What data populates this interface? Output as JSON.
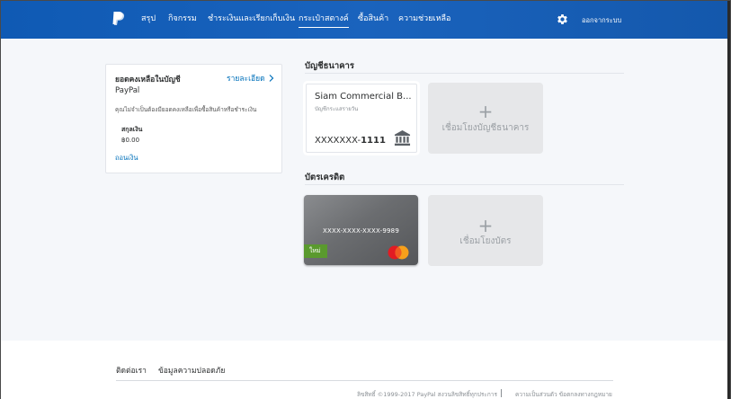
{
  "header": {
    "nav": [
      {
        "label": "สรุป"
      },
      {
        "label": "กิจกรรม"
      },
      {
        "label": "ชำระเงินและเรียกเก็บเงิน"
      },
      {
        "label": "กระเป๋าสตางค์"
      },
      {
        "label": "ซื้อสินค้า"
      },
      {
        "label": "ความช่วยเหลือ"
      }
    ],
    "active_tab": "กระเป๋าสตางค์",
    "logout_label": "ออกจากระบบ",
    "settings_icon": "gear-icon",
    "logo_icon": "paypal-logo-icon"
  },
  "balance": {
    "title": "ยอดคงเหลือในบัญชี",
    "details_link": "รายละเอียด",
    "account_name": "PayPal",
    "note": "คุณไม่จำเป็นต้องมียอดคงเหลือเพื่อซื้อสินค้าหรือชำระเงิน",
    "currency_label": "สกุลเงิน",
    "currency_value": "฿0.00",
    "withdraw_link": "ถอนเงิน"
  },
  "bank_section": {
    "title": "บัญชีธนาคาร",
    "bank_name": "Siam Commercial B...",
    "account_type": "บัญชีกระแสรายวัน",
    "account_mask": "XXXXXXX-",
    "account_last": "1111",
    "add_plus": "+",
    "add_label": "เชื่อมโยงบัญชีธนาคาร"
  },
  "card_section": {
    "title": "บัตรเครดิต",
    "card_number": "XXXX-XXXX-XXXX-9989",
    "new_badge": "ใหม่",
    "brand": "MasterCard",
    "add_plus": "+",
    "add_label": "เชื่อมโยงบัตร"
  },
  "footer": {
    "contact": "ติดต่อเรา",
    "security": "ข้อมูลความปลอดภัย",
    "copyright": "ลิขสิทธิ์ ©1999-2017 PayPal สงวนลิขสิทธิ์ทุกประการ",
    "links": "ความเป็นส่วนตัว   ข้อตกลงทางกฎหมาย"
  },
  "colors": {
    "header_blue": "#1a63bd",
    "link_blue": "#0070ba",
    "new_green": "#5a9a2e"
  }
}
